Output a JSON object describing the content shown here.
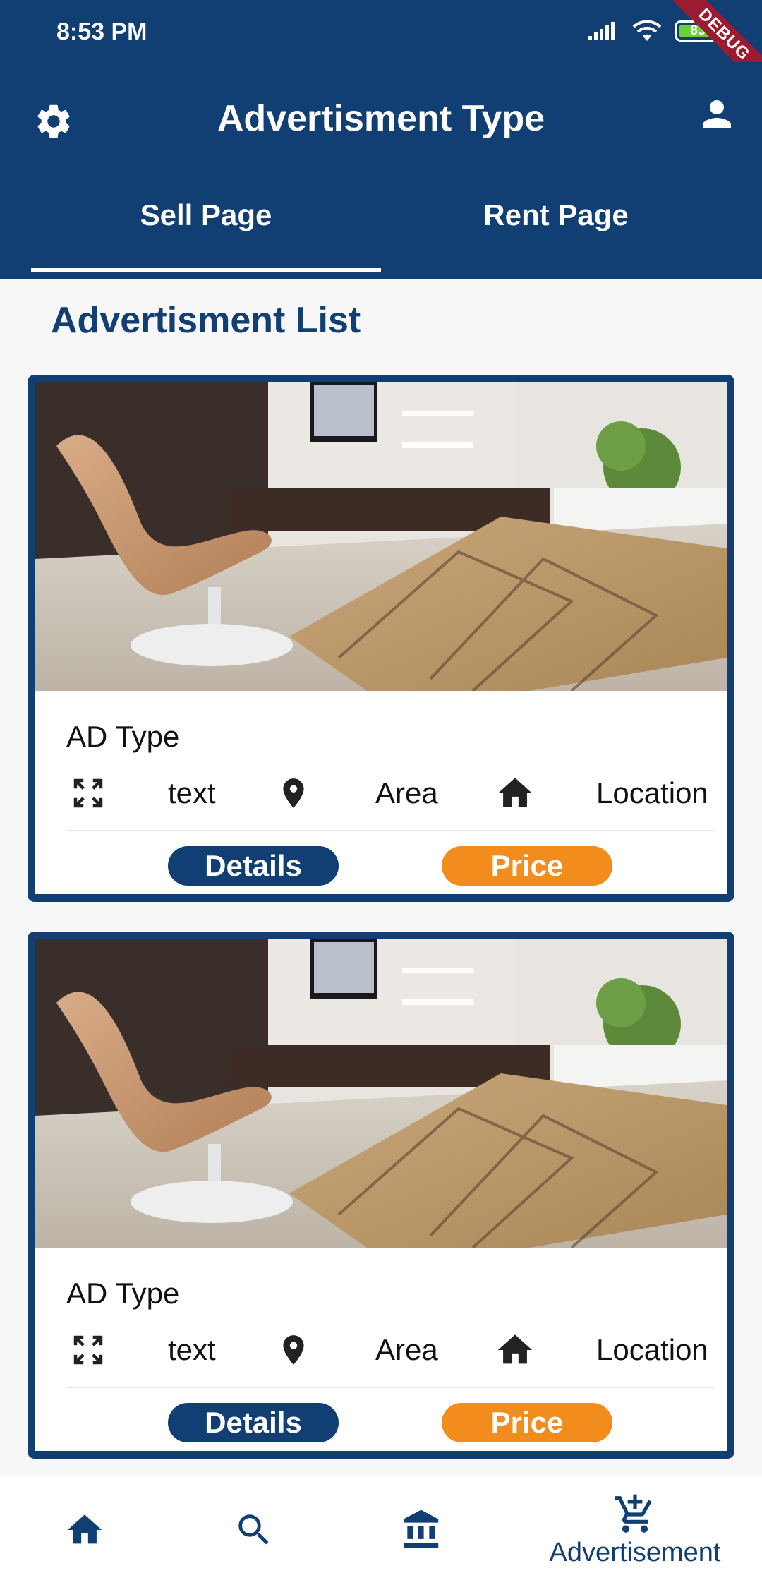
{
  "status": {
    "time": "8:53 PM",
    "battery": "83",
    "ribbon": "DEBUG"
  },
  "header": {
    "title": "Advertisment Type"
  },
  "tabs": [
    {
      "label": "Sell Page",
      "active": true
    },
    {
      "label": "Rent Page",
      "active": false
    }
  ],
  "section": {
    "title": "Advertisment List"
  },
  "cards": [
    {
      "ad_type": "AD Type",
      "size": "text",
      "area": "Area",
      "location": "Location",
      "details_label": "Details",
      "price_label": "Price"
    },
    {
      "ad_type": "AD Type",
      "size": "text",
      "area": "Area",
      "location": "Location",
      "details_label": "Details",
      "price_label": "Price"
    }
  ],
  "bottom_nav": {
    "active_label": "Advertisement",
    "items": [
      {
        "icon": "home-icon"
      },
      {
        "icon": "search-icon"
      },
      {
        "icon": "bank-icon"
      },
      {
        "icon": "add-cart-icon",
        "label": "Advertisement"
      }
    ]
  },
  "colors": {
    "primary": "#113f73",
    "accent": "#f28c1c",
    "background": "#f7f7f7",
    "battery": "#6bd136"
  }
}
